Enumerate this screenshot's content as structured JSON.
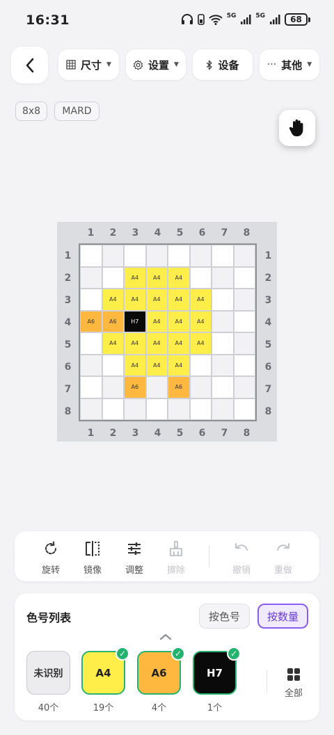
{
  "status_bar": {
    "time": "16:31",
    "battery": "68",
    "net1": "5G",
    "net2": "5G"
  },
  "toolbar": {
    "size_label": "尺寸",
    "settings_label": "设置",
    "device_label": "设备",
    "more_label": "其他"
  },
  "tags": {
    "grid_size": "8x8",
    "brand": "MARD"
  },
  "grid": {
    "rows": 8,
    "cols": 8,
    "col_labels": [
      "1",
      "2",
      "3",
      "4",
      "5",
      "6",
      "7",
      "8"
    ],
    "row_labels": [
      "1",
      "2",
      "3",
      "4",
      "5",
      "6",
      "7",
      "8"
    ],
    "cells": [
      [
        "",
        "",
        "",
        "",
        "",
        "",
        "",
        ""
      ],
      [
        "",
        "",
        "A4",
        "A4",
        "A4",
        "",
        "",
        ""
      ],
      [
        "",
        "A4",
        "A4",
        "A4",
        "A4",
        "A4",
        "",
        ""
      ],
      [
        "A6",
        "A6",
        "H7",
        "A4",
        "A4",
        "A4",
        "",
        ""
      ],
      [
        "",
        "A4",
        "A4",
        "A4",
        "A4",
        "A4",
        "",
        ""
      ],
      [
        "",
        "",
        "A4",
        "A4",
        "A4",
        "",
        "",
        ""
      ],
      [
        "",
        "",
        "A6",
        "",
        "A6",
        "",
        "",
        ""
      ],
      [
        "",
        "",
        "",
        "",
        "",
        "",
        "",
        ""
      ]
    ]
  },
  "tools": {
    "rotate": "旋转",
    "mirror": "镜像",
    "adjust": "调整",
    "erase": "擦除",
    "undo": "撤销",
    "redo": "重做"
  },
  "palette": {
    "title": "色号列表",
    "sort_by_code": "按色号",
    "sort_by_count": "按数量",
    "unknown_label": "未识别",
    "unknown_count": "40个",
    "colors": [
      {
        "code": "A4",
        "count": "19个",
        "hex": "#ffed4a"
      },
      {
        "code": "A6",
        "count": "4个",
        "hex": "#ffb83f"
      },
      {
        "code": "H7",
        "count": "1个",
        "hex": "#0a0a0a"
      }
    ],
    "all_label": "全部"
  }
}
